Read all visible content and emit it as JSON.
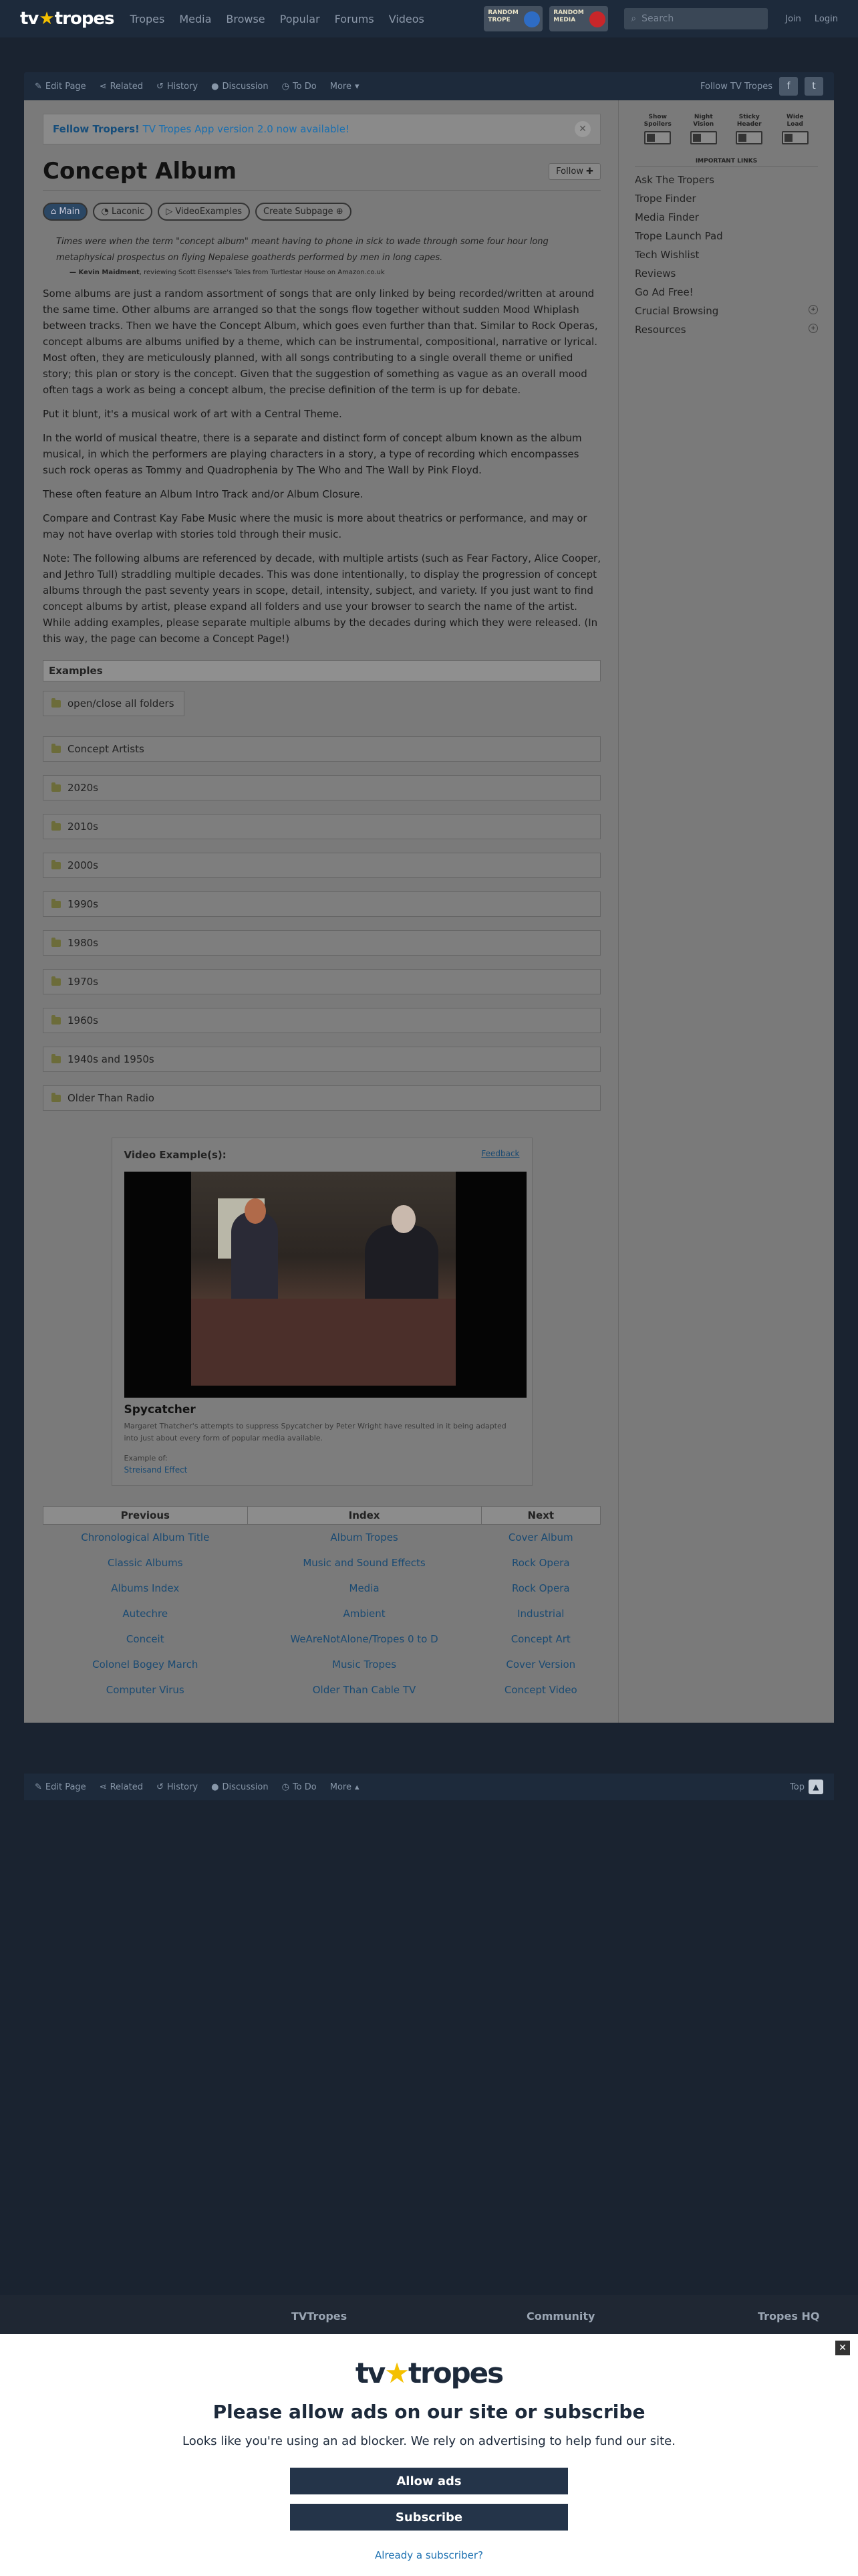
{
  "header": {
    "logo_left": "tv",
    "logo_right": "tropes",
    "nav": [
      "Tropes",
      "Media",
      "Browse",
      "Popular",
      "Forums",
      "Videos"
    ],
    "promo1": "RANDOM TROPE",
    "promo2": "RANDOM MEDIA",
    "search_placeholder": "Search",
    "join": "Join",
    "login": "Login"
  },
  "toolbar": {
    "items": [
      "Edit Page",
      "Related",
      "History",
      "Discussion",
      "To Do",
      "More"
    ],
    "follow": "Follow TV Tropes"
  },
  "notice": {
    "bold": "Fellow Tropers!",
    "text": " TV Tropes App version 2.0 now available!"
  },
  "page": {
    "title": "Concept Album",
    "follow_btn": "Follow",
    "tabs": [
      "Main",
      "Laconic",
      "VideoExamples",
      "Create Subpage"
    ]
  },
  "quote": {
    "text": "Times were when the term \"concept album\" meant having to phone in sick to wade through some four hour long metaphysical prospectus on flying Nepalese goatherds performed by men in long capes.",
    "source_name": "— Kevin Maidment",
    "source_rest": ", reviewing Scott Elsensse's Tales from Turtlestar House on Amazon.co.uk"
  },
  "paras": [
    "Some albums are just a random assortment of songs that are only linked by being recorded/written at around the same time. Other albums are arranged so that the songs flow together without sudden Mood Whiplash between tracks. Then we have the Concept Album, which goes even further than that. Similar to Rock Operas, concept albums are albums unified by a theme, which can be instrumental, compositional, narrative or lyrical. Most often, they are meticulously planned, with all songs contributing to a single overall theme or unified story; this plan or story is the concept. Given that the suggestion of something as vague as an overall mood often tags a work as being a concept album, the precise definition of the term is up for debate.",
    "Put it blunt, it's a musical work of art with a Central Theme.",
    "In the world of musical theatre, there is a separate and distinct form of concept album known as the album musical, in which the performers are playing characters in a story, a type of recording which encompasses such rock operas as Tommy and Quadrophenia by The Who and The Wall by Pink Floyd.",
    "These often feature an Album Intro Track and/or Album Closure.",
    "Compare and Contrast Kay Fabe Music where the music is more about theatrics or performance, and may or may not have overlap with stories told through their music.",
    "Note: The following albums are referenced by decade, with multiple artists (such as Fear Factory, Alice Cooper, and Jethro Tull) straddling multiple decades. This was done intentionally, to display the progression of concept albums through the past seventy years in scope, detail, intensity, subject, and variety. If you just want to find concept albums by artist, please expand all folders and use your browser to search the name of the artist. While adding examples, please separate multiple albums by the decades during which they were released. (In this way, the page can become a Concept Page!)"
  ],
  "examples": {
    "heading": "Examples",
    "toggle_all": "open/close all folders",
    "folders": [
      "Concept Artists",
      "2020s",
      "2010s",
      "2000s",
      "1990s",
      "1980s",
      "1970s",
      "1960s",
      "1940s and 1950s",
      "Older Than Radio"
    ]
  },
  "video": {
    "heading": "Video Example(s):",
    "feedback": "Feedback",
    "title": "Spycatcher",
    "desc": "Margaret Thatcher's attempts to suppress Spycatcher by Peter Wright have resulted in it being adapted into just about every form of popular media available.",
    "example_of": "Example of:",
    "trope": "Streisand Effect"
  },
  "navtable": {
    "headers": [
      "Previous",
      "Index",
      "Next"
    ],
    "rows": [
      [
        "Chronological Album Title",
        "Album Tropes",
        "Cover Album"
      ],
      [
        "Classic Albums",
        "Music and Sound Effects",
        "Rock Opera"
      ],
      [
        "Albums Index",
        "Media",
        "Rock Opera"
      ],
      [
        "Autechre",
        "Ambient",
        "Industrial"
      ],
      [
        "Conceit",
        "WeAreNotAlone/Tropes 0 to D",
        "Concept Art"
      ],
      [
        "Colonel Bogey March",
        "Music Tropes",
        "Cover Version"
      ],
      [
        "Computer Virus",
        "Older Than Cable TV",
        "Concept Video"
      ]
    ]
  },
  "sidebar": {
    "toggles": [
      "Show Spoilers",
      "Night Vision",
      "Sticky Header",
      "Wide Load"
    ],
    "important": "IMPORTANT LINKS",
    "links": [
      "Ask The Tropers",
      "Trope Finder",
      "Media Finder",
      "Trope Launch Pad",
      "Tech Wishlist",
      "Reviews",
      "Go Ad Free!",
      "Crucial Browsing",
      "Resources"
    ]
  },
  "bottombar": {
    "items": [
      "Edit Page",
      "Related",
      "History",
      "Discussion",
      "To Do",
      "More"
    ],
    "top": "Top"
  },
  "footer": {
    "col1": "TVTropes",
    "col2": "Community",
    "col3": "Tropes HQ"
  },
  "modal": {
    "logo_left": "tv",
    "logo_right": "tropes",
    "title": "Please allow ads on our site or subscribe",
    "text": "Looks like you're using an ad blocker. We rely on advertising to help fund our site.",
    "allow": "Allow ads",
    "subscribe": "Subscribe",
    "already": "Already a subscriber?"
  }
}
